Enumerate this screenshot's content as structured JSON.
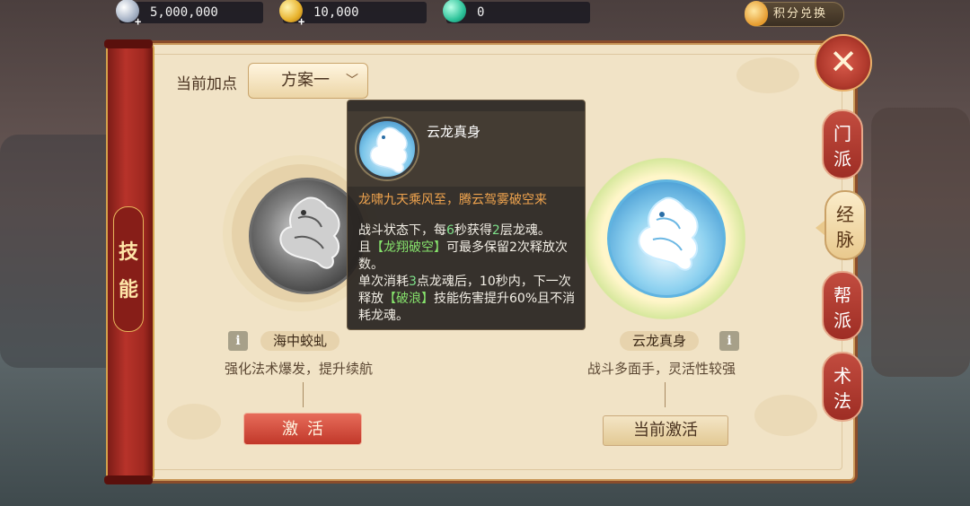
{
  "topbar": {
    "silver": "5,000,000",
    "gold": "10,000",
    "jade": "0",
    "exchange_label": "积分兑换",
    "plus": "+"
  },
  "scroll": {
    "label_1": "技",
    "label_2": "能"
  },
  "close_label": "✕",
  "tabs": [
    {
      "line1": "门",
      "line2": "派",
      "active": false
    },
    {
      "line1": "经",
      "line2": "脉",
      "active": true
    },
    {
      "line1": "帮",
      "line2": "派",
      "active": false
    },
    {
      "line1": "术",
      "line2": "法",
      "active": false
    }
  ],
  "plan": {
    "label": "当前加点",
    "value": "方案一",
    "chevron": "﹀"
  },
  "left_skill": {
    "name": "海中蛟虬",
    "desc": "强化法术爆发，提升续航",
    "button": "激活"
  },
  "right_skill": {
    "name": "云龙真身",
    "desc": "战斗多面手，灵活性较强",
    "button": "当前激活"
  },
  "info_icon": "i",
  "tooltip": {
    "title": "云龙真身",
    "motto": "龙啸九天乘风至，腾云驾雾破空来",
    "p1_a": "战斗状态下，每",
    "p1_num1": "6",
    "p1_b": "秒获得",
    "p1_num2": "2",
    "p1_c": "层龙魂。",
    "p2_a": "且",
    "p2_kw": "【龙翔破空】",
    "p2_b": "可最多保留2次释放次数。",
    "p3_a": "单次消耗",
    "p3_num": "3",
    "p3_b": "点龙魂后，10秒内，下一次释放",
    "p3_kw": "【破浪】",
    "p3_c": "技能伤害提升60%且不消耗龙魂。"
  },
  "colors": {
    "scroll_red": "#b7332a",
    "panel_bg": "#f1e3c6",
    "activate_red": "#c1382a",
    "tooltip_orange": "#f0a44e",
    "tooltip_green": "#7ee08a"
  }
}
